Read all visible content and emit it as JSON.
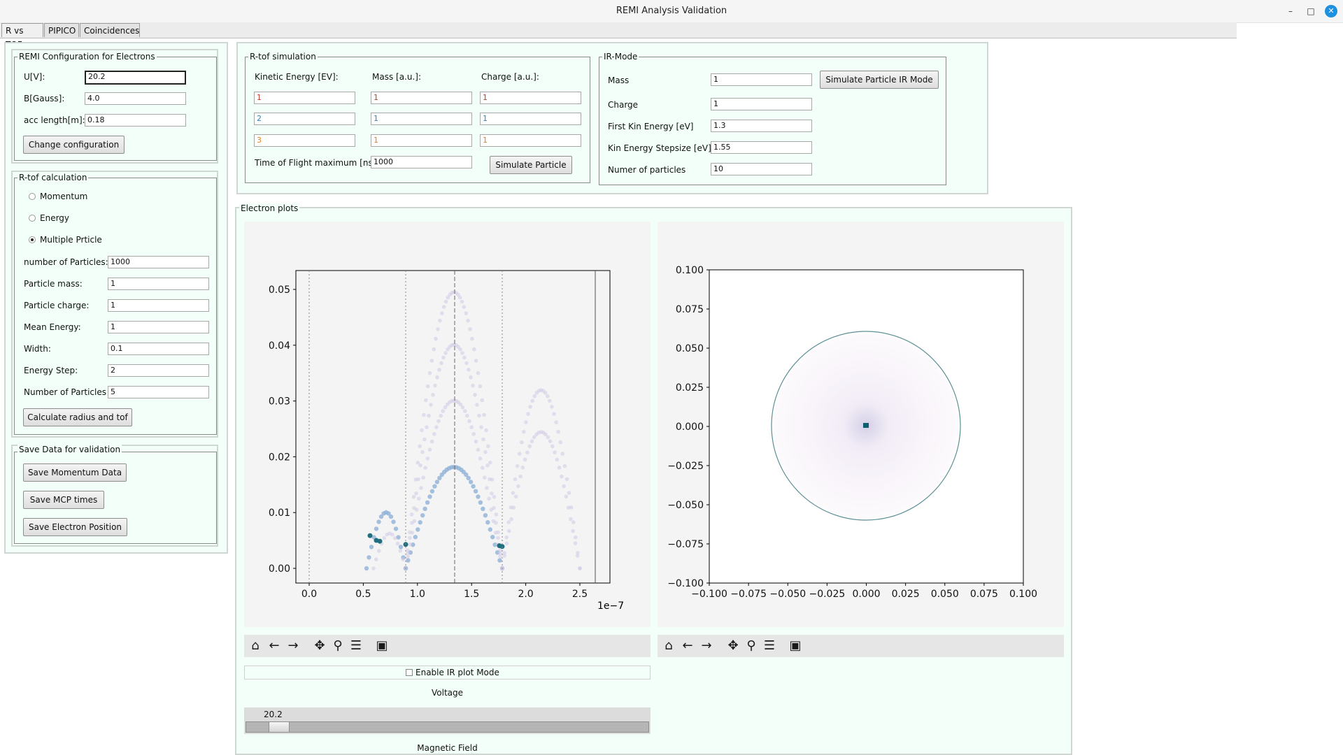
{
  "window": {
    "title": "REMI Analysis Validation",
    "minimize": "–",
    "maximize": "□",
    "close": "✕"
  },
  "tabs": [
    "R vs TOF",
    "PIPICO",
    "Coincidences"
  ],
  "config": {
    "title": "REMI Configuration for Electrons",
    "u_label": "U[V]:",
    "u_value": "20.2",
    "b_label": "B[Gauss]:",
    "b_value": "4.0",
    "acc_label": "acc length[m]:",
    "acc_value": "0.18",
    "button": "Change configuration"
  },
  "rtof_calc": {
    "title": "R-tof calculation",
    "options": [
      {
        "label": "Momentum",
        "checked": false
      },
      {
        "label": "Energy",
        "checked": false
      },
      {
        "label": "Multiple Prticle",
        "checked": true
      }
    ],
    "fields": [
      {
        "label": "number of Particles:",
        "value": "1000"
      },
      {
        "label": "Particle mass:",
        "value": "1"
      },
      {
        "label": "Particle charge:",
        "value": "1"
      },
      {
        "label": "Mean Energy:",
        "value": "1"
      },
      {
        "label": "Width:",
        "value": "0.1"
      },
      {
        "label": "Energy Step:",
        "value": "2"
      },
      {
        "label": "Number of Particles",
        "value": "5"
      }
    ],
    "button": "Calculate radius and tof"
  },
  "save": {
    "title": "Save Data for validation",
    "buttons": [
      "Save Momentum Data",
      "Save MCP times",
      "Save Electron Position"
    ]
  },
  "rtof_sim": {
    "title": "R-tof simulation",
    "headers": [
      "Kinetic Energy [EV]:",
      "Mass [a.u.]:",
      "Charge [a.u.]:"
    ],
    "rows": [
      {
        "values": [
          "1",
          "1",
          "1"
        ],
        "color": "#c0392b"
      },
      {
        "values": [
          "2",
          "1",
          "1"
        ],
        "color": "#2e86c1"
      },
      {
        "values": [
          "3",
          "1",
          "1"
        ],
        "color": "#e67e22"
      }
    ],
    "tof_label": "Time of Flight maximum [ns]:",
    "tof_value": "1000",
    "button": "Simulate Particle"
  },
  "ir_mode": {
    "title": "IR-Mode",
    "fields": [
      {
        "label": "Mass",
        "value": "1"
      },
      {
        "label": "Charge",
        "value": "1"
      },
      {
        "label": "First Kin Energy [eV]",
        "value": "1.3"
      },
      {
        "label": "Kin Energy Stepsize [eV]",
        "value": "1.55"
      },
      {
        "label": "Numer of particles",
        "value": "10"
      }
    ],
    "button": "Simulate Particle IR Mode"
  },
  "plots": {
    "title": "Electron plots",
    "left_plot": {
      "y_ticks": [
        "0.00",
        "0.01",
        "0.02",
        "0.03",
        "0.04",
        "0.05"
      ],
      "x_ticks": [
        "0.0",
        "0.5",
        "1.0",
        "1.5",
        "2.0",
        "2.5"
      ],
      "x_offset": "1e−7"
    },
    "right_plot": {
      "y_ticks": [
        "0.100",
        "0.075",
        "0.050",
        "0.025",
        "0.000",
        "−0.025",
        "−0.050",
        "−0.075",
        "−0.100"
      ],
      "x_ticks": [
        "−0.100",
        "−0.075",
        "−0.050",
        "−0.025",
        "0.000",
        "0.025",
        "0.050",
        "0.075",
        "0.100"
      ]
    },
    "toolbar_icons": [
      "home-icon",
      "back-arrow-icon",
      "forward-arrow-icon",
      "pan-icon",
      "zoom-icon",
      "configure-icon",
      "save-icon"
    ],
    "ir_checkbox_label": "Enable IR plot Mode",
    "ir_checkbox_checked": false,
    "voltage_label": "Voltage",
    "voltage_value": "20.2",
    "voltage_fraction": 0.06,
    "magnetic_label": "Magnetic Field"
  }
}
